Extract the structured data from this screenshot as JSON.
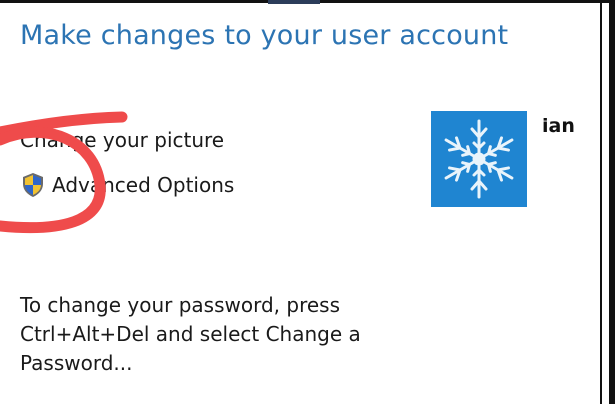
{
  "dialog": {
    "title": "Make changes to your user account"
  },
  "links": {
    "change_picture": "Change your picture",
    "advanced_options": "Advanced Options"
  },
  "user": {
    "name": "ian",
    "picture": "snowflake-avatar"
  },
  "password_note": {
    "line1": "To change your password, press",
    "line2": "Ctrl+Alt+Del and select Change a",
    "line3": "Password..."
  },
  "icons": {
    "shield": "uac-shield-icon"
  },
  "colors": {
    "title": "#2c74b3",
    "avatar_bg": "#1f85d1",
    "annotation": "#ef4b4b"
  }
}
